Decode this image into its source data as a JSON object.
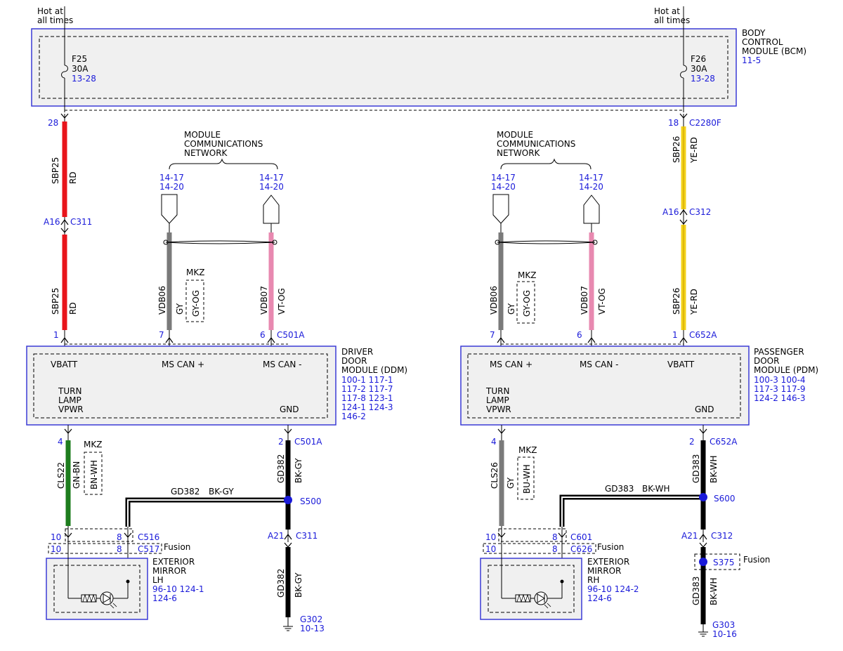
{
  "colors": {
    "red": "#e8141b",
    "yellow": "#f3d21a",
    "gray": "#7a7a7a",
    "pink": "#e889b0",
    "green": "#1e7d1e",
    "black": "#000000",
    "blue_ref": "#1a1ad9",
    "module_border": "#3a3ad6",
    "module_fill": "#f0f0f0"
  },
  "power": {
    "hot_left": [
      "Hot at",
      "all times"
    ],
    "hot_right": [
      "Hot at",
      "all times"
    ]
  },
  "bcm": {
    "title": [
      "BODY",
      "CONTROL",
      "MODULE (BCM)"
    ],
    "ref": "11-5",
    "fuse_left": {
      "id": "F25",
      "rating": "30A",
      "ref": "13-28"
    },
    "fuse_right": {
      "id": "F26",
      "rating": "30A",
      "ref": "13-28"
    }
  },
  "network": {
    "left": [
      "MODULE",
      "COMMUNICATIONS",
      "NETWORK"
    ],
    "right": [
      "MODULE",
      "COMMUNICATIONS",
      "NETWORK"
    ],
    "refs": [
      "14-17",
      "14-20"
    ]
  },
  "left_circuits": {
    "pin_28": "28",
    "sbp25": "SBP25",
    "rd": "RD",
    "a16": "A16",
    "c311": "C311",
    "vdb06": "VDB06",
    "gy": "GY",
    "mkz": "MKZ",
    "gy_og": "GY-OG",
    "vdb07": "VDB07",
    "vt_og": "VT-OG",
    "pin_1": "1",
    "pin_7": "7",
    "pin_6": "6",
    "c501a": "C501A"
  },
  "ddm": {
    "title": [
      "DRIVER",
      "DOOR",
      "MODULE (DDM)"
    ],
    "refs": [
      "100-1   117-1",
      "117-2   117-7",
      "117-8   123-1",
      "124-1   124-3",
      "146-2"
    ],
    "vbatt": "VBATT",
    "mscan_plus": "MS CAN +",
    "mscan_minus": "MS CAN -",
    "turn": [
      "TURN",
      "LAMP",
      "VPWR"
    ],
    "gnd": "GND"
  },
  "left_lower": {
    "pin_4": "4",
    "cls22": "CLS22",
    "gn_bn": "GN-BN",
    "mkz": "MKZ",
    "bn_wh": "BN-WH",
    "pin_2": "2",
    "c501a": "C501A",
    "gd382": "GD382",
    "bk_gy": "BK-GY",
    "splice": "S500",
    "a21": "A21",
    "c311": "C311",
    "ground": "G302",
    "ground_ref": "10-13",
    "pin_10a": "10",
    "pin_8a": "8",
    "c516": "C516",
    "pin_10b": "10",
    "pin_8b": "8",
    "c517": "C517",
    "fusion": "Fusion"
  },
  "mirror_lh": {
    "title": [
      "EXTERIOR",
      "MIRROR",
      "LH"
    ],
    "refs": [
      "96-10   124-1",
      "124-6"
    ]
  },
  "right_circuits": {
    "vdb06": "VDB06",
    "gy": "GY",
    "mkz": "MKZ",
    "gy_og": "GY-OG",
    "vdb07": "VDB07",
    "vt_og": "VT-OG",
    "pin_18": "18",
    "c2280f": "C2280F",
    "sbp26": "SBP26",
    "ye_rd": "YE-RD",
    "a16": "A16",
    "c312": "C312",
    "pin_7": "7",
    "pin_6": "6",
    "pin_1": "1",
    "c652a": "C652A"
  },
  "pdm": {
    "title": [
      "PASSENGER",
      "DOOR",
      "MODULE (PDM)"
    ],
    "refs": [
      "100-3   100-4",
      "117-3   117-9",
      "124-2   146-3"
    ],
    "mscan_plus": "MS CAN +",
    "mscan_minus": "MS CAN -",
    "vbatt": "VBATT",
    "turn": [
      "TURN",
      "LAMP",
      "VPWR"
    ],
    "gnd": "GND"
  },
  "right_lower": {
    "pin_4": "4",
    "cls26": "CLS26",
    "gy": "GY",
    "mkz": "MKZ",
    "bu_wh": "BU-WH",
    "pin_2": "2",
    "c652a": "C652A",
    "gd383": "GD383",
    "bk_wh": "BK-WH",
    "splice": "S600",
    "a21": "A21",
    "c312": "C312",
    "splice2": "S375",
    "fusion2": "Fusion",
    "ground": "G303",
    "ground_ref": "10-16",
    "pin_10a": "10",
    "pin_8a": "8",
    "c601": "C601",
    "pin_10b": "10",
    "pin_8b": "8",
    "c626": "C626",
    "fusion": "Fusion"
  },
  "mirror_rh": {
    "title": [
      "EXTERIOR",
      "MIRROR",
      "RH"
    ],
    "refs": [
      "96-10   124-2",
      "124-6"
    ]
  }
}
